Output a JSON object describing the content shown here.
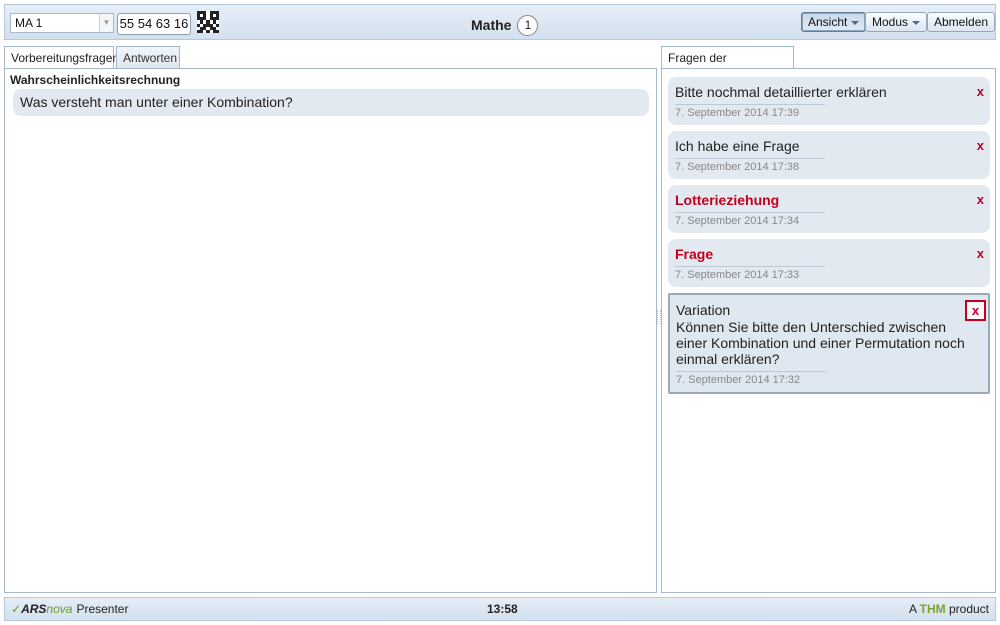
{
  "header": {
    "course_select_value": "MA 1",
    "session_key": "55 54 63 16",
    "course_title": "Mathe",
    "online_count": "1",
    "buttons": {
      "view_label": "Ansicht",
      "mode_label": "Modus",
      "logout_label": "Abmelden"
    },
    "qr_icon": "qr-code-icon"
  },
  "left_panel": {
    "tabs": [
      {
        "label": "Vorbereitungsfragen",
        "active": true
      },
      {
        "label": "Antworten",
        "active": false
      }
    ],
    "question_heading": "Wahrscheinlichkeitsrechnung",
    "question_text": "Was versteht man unter einer Kombination?"
  },
  "right_panel": {
    "tab_label": "Fragen der Studierenden",
    "delete_glyph": "x",
    "questions": [
      {
        "subject": "Bitte nochmal detaillierter erklären",
        "body": "",
        "date": "7. September 2014 17:39",
        "unread": false,
        "selected": false
      },
      {
        "subject": "Ich habe eine Frage",
        "body": "",
        "date": "7. September 2014 17:38",
        "unread": false,
        "selected": false
      },
      {
        "subject": "Lotterieziehung",
        "body": "",
        "date": "7. September 2014 17:34",
        "unread": true,
        "selected": false
      },
      {
        "subject": "Frage",
        "body": "",
        "date": "7. September 2014 17:33",
        "unread": true,
        "selected": false
      },
      {
        "subject": "Variation",
        "body": "Können Sie bitte den Unterschied zwischen einer Kombination und einer Permutation noch einmal erklären?",
        "date": "7. September 2014 17:32",
        "unread": false,
        "selected": true
      }
    ]
  },
  "footer": {
    "logo_ars": "ARS",
    "logo_nova": "nova",
    "product_name": "Presenter",
    "clock": "13:58",
    "credit_prefix": "A",
    "credit_brand": "THM",
    "credit_suffix": "product"
  },
  "colors": {
    "accent_red": "#c4001d",
    "thm_green": "#7aa52a",
    "bubble": "#e2e9f1"
  }
}
